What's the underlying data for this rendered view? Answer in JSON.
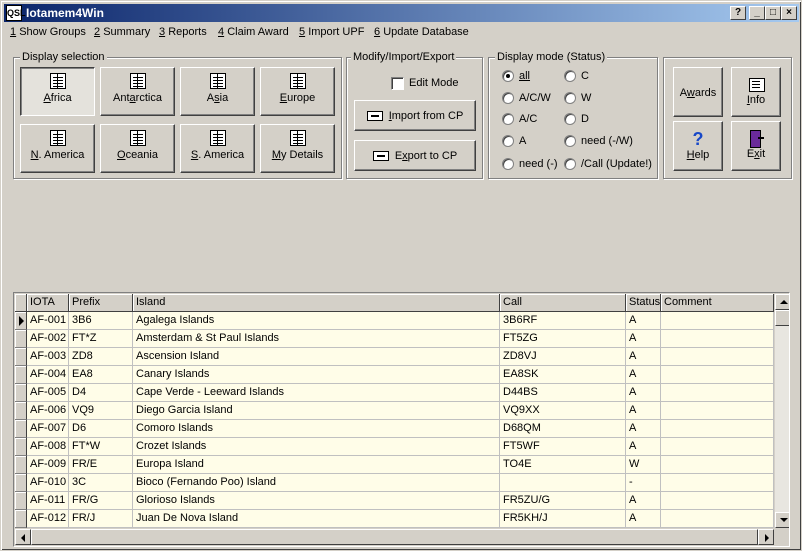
{
  "window": {
    "title": "Iotamem4Win",
    "app_icon": "QSL",
    "controls": {
      "help": "?",
      "minimize": "_",
      "maximize": "□",
      "close": "×"
    }
  },
  "menu": [
    {
      "key": "1",
      "label": "Show Groups"
    },
    {
      "key": "2",
      "label": "Summary"
    },
    {
      "key": "3",
      "label": "Reports"
    },
    {
      "key": "4",
      "label": "Claim Award"
    },
    {
      "key": "5",
      "label": "Import UPF"
    },
    {
      "key": "6",
      "label": "Update Database"
    }
  ],
  "display_selection": {
    "label": "Display selection",
    "selected": "Africa",
    "buttons": [
      {
        "key": "A",
        "rest": "frica"
      },
      {
        "pre": "Ant",
        "key": "a",
        "rest": "rctica"
      },
      {
        "pre": "A",
        "key": "s",
        "rest": "ia"
      },
      {
        "key": "E",
        "rest": "urope"
      },
      {
        "key": "N",
        "rest": ". America"
      },
      {
        "key": "O",
        "rest": "ceania"
      },
      {
        "key": "S",
        "rest": ". America"
      },
      {
        "key": "M",
        "rest": "y Details"
      }
    ]
  },
  "modify": {
    "label": "Modify/Import/Export",
    "edit_mode": "Edit Mode",
    "edit_mode_checked": false,
    "import": {
      "key": "I",
      "rest": "mport from CP"
    },
    "export": {
      "pre": "E",
      "key": "x",
      "rest": "port to CP"
    }
  },
  "display_mode": {
    "label": "Display mode (Status)",
    "selected": "all",
    "options": [
      {
        "label": "all"
      },
      {
        "label": "C"
      },
      {
        "label": "A/C/W"
      },
      {
        "label": "W"
      },
      {
        "label": "A/C"
      },
      {
        "label": "D"
      },
      {
        "label": "A"
      },
      {
        "label": "need (-/W)"
      },
      {
        "label": "need (-)"
      },
      {
        "label": "/Call (Update!)"
      }
    ]
  },
  "actions": {
    "awards": {
      "pre": "A",
      "key": "w",
      "rest": "ards"
    },
    "info": {
      "key": "I",
      "rest": "nfo"
    },
    "help": {
      "key": "H",
      "rest": "elp"
    },
    "exit": {
      "pre": "E",
      "key": "x",
      "rest": "it"
    },
    "icons": {
      "awards": "none",
      "info": "document-icon",
      "help": "question-icon",
      "exit": "door-icon"
    }
  },
  "table": {
    "columns": [
      "IOTA",
      "Prefix",
      "Island",
      "Call",
      "Status",
      "Comment"
    ],
    "current_row": 0,
    "rows": [
      [
        "AF-001",
        "3B6",
        "Agalega Islands",
        "3B6RF",
        "A",
        ""
      ],
      [
        "AF-002",
        "FT*Z",
        "Amsterdam & St Paul Islands",
        "FT5ZG",
        "A",
        ""
      ],
      [
        "AF-003",
        "ZD8",
        "Ascension Island",
        "ZD8VJ",
        "A",
        ""
      ],
      [
        "AF-004",
        "EA8",
        "Canary Islands",
        "EA8SK",
        "A",
        ""
      ],
      [
        "AF-005",
        "D4",
        "Cape Verde - Leeward Islands",
        "D44BS",
        "A",
        ""
      ],
      [
        "AF-006",
        "VQ9",
        "Diego Garcia Island",
        "VQ9XX",
        "A",
        ""
      ],
      [
        "AF-007",
        "D6",
        "Comoro Islands",
        "D68QM",
        "A",
        ""
      ],
      [
        "AF-008",
        "FT*W",
        "Crozet Islands",
        "FT5WF",
        "A",
        ""
      ],
      [
        "AF-009",
        "FR/E",
        "Europa Island",
        "TO4E",
        "W",
        ""
      ],
      [
        "AF-010",
        "3C",
        "Bioco (Fernando Poo) Island",
        "",
        "-",
        ""
      ],
      [
        "AF-011",
        "FR/G",
        "Glorioso Islands",
        "FR5ZU/G",
        "A",
        ""
      ],
      [
        "AF-012",
        "FR/J",
        "Juan De Nova Island",
        "FR5KH/J",
        "A",
        ""
      ]
    ]
  },
  "colors": {
    "title_start": "#0a246a",
    "title_end": "#a6caf0",
    "grid_bg": "#fffde8",
    "face": "#d4d0c8"
  }
}
